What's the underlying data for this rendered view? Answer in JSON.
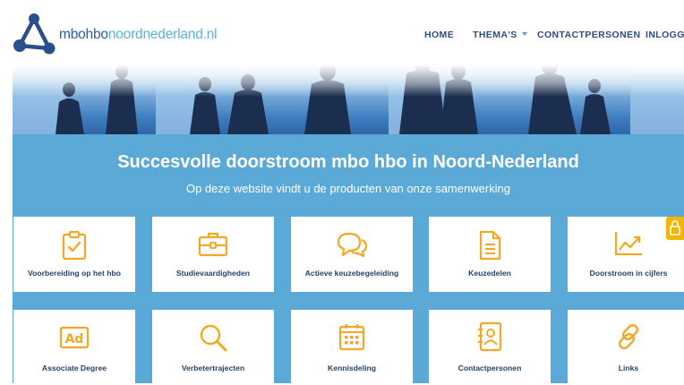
{
  "site": {
    "logo_part1": "mbohbo",
    "logo_part2": "noordnederland.nl"
  },
  "nav": {
    "items": [
      {
        "label": "HOME"
      },
      {
        "label": "THEMA'S"
      },
      {
        "label": "CONTACTPERSONEN"
      },
      {
        "label": "INLOGGEN"
      }
    ]
  },
  "hero": {
    "title": "Succesvolle doorstroom mbo hbo in Noord-Nederland",
    "subtitle": "Op deze website vindt u de producten van onze samenwerking"
  },
  "tiles": [
    {
      "label": "Voorbereiding op het hbo",
      "icon": "clipboard-check-icon"
    },
    {
      "label": "Studievaardigheden",
      "icon": "briefcase-icon"
    },
    {
      "label": "Actieve keuzebegeleiding",
      "icon": "chat-bubbles-icon"
    },
    {
      "label": "Keuzedelen",
      "icon": "document-icon"
    },
    {
      "label": "Doorstroom in cijfers",
      "icon": "trend-chart-icon"
    },
    {
      "label": "Associate Degree",
      "icon": "ad-icon"
    },
    {
      "label": "Verbetertrajecten",
      "icon": "search-icon"
    },
    {
      "label": "Kennisdeling",
      "icon": "calendar-icon"
    },
    {
      "label": "Contactpersonen",
      "icon": "contact-book-icon"
    },
    {
      "label": "Links",
      "icon": "link-icon"
    }
  ],
  "colors": {
    "accent": "#f5a623",
    "panel": "#5ba9d6",
    "nav_text": "#2d4e84",
    "logo": "#2b5aa8"
  }
}
